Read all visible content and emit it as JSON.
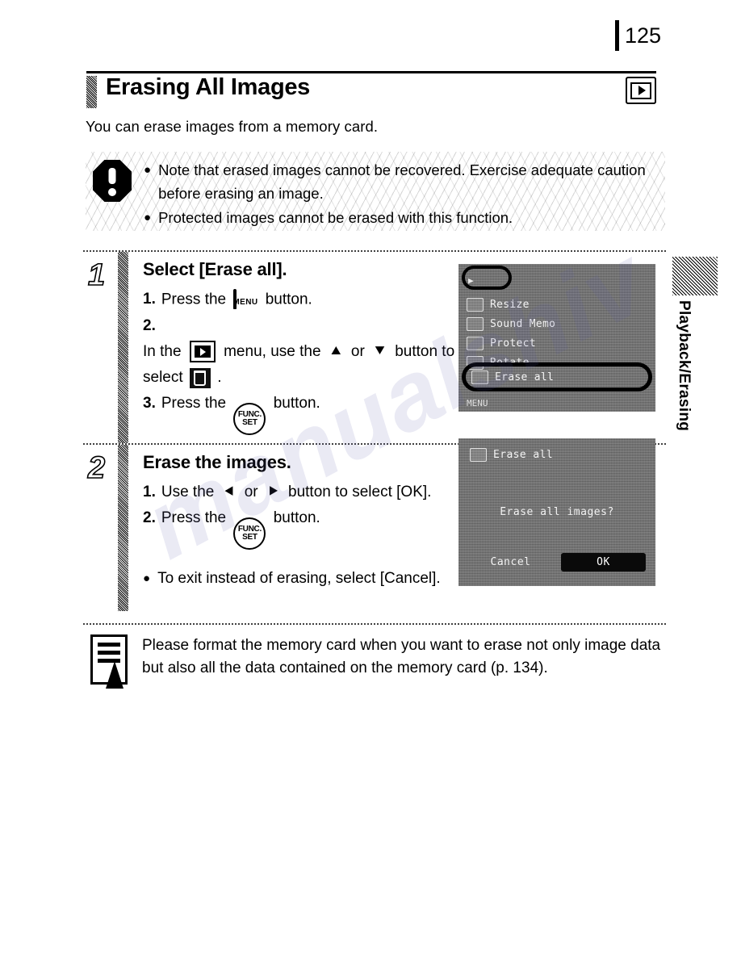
{
  "page": {
    "number": "125",
    "watermark": "manualshiv"
  },
  "header": {
    "title": "Erasing All Images",
    "mode_icon": "playback-icon",
    "intro": "You can erase images from a memory card."
  },
  "caution": {
    "icon": "exclamation-octagon-icon",
    "items": [
      "Note that erased images cannot be recovered. Exercise adequate caution before erasing an image.",
      "Protected images cannot be erased with this function."
    ]
  },
  "steps": [
    {
      "number": "1",
      "heading": "Select [Erase all].",
      "substeps": [
        {
          "marker": "1.",
          "before": "Press the",
          "icon": "menu-button-icon",
          "after": "button."
        },
        {
          "marker": "2.",
          "before": "In the",
          "icon": "playback-menu-icon",
          "mid": "menu, use the",
          "icon2": "up-arrow-icon",
          "or": "or",
          "icon3": "down-arrow-icon",
          "after": "button to select",
          "icon4": "erase-all-trash-icon",
          "tail": "."
        },
        {
          "marker": "3.",
          "before": "Press the",
          "icon": "func-set-button-icon",
          "after": "button."
        }
      ]
    },
    {
      "number": "2",
      "heading": "Erase the images.",
      "substeps": [
        {
          "marker": "1.",
          "before": "Use the",
          "icon": "left-arrow-icon",
          "or": "or",
          "icon2": "right-arrow-icon",
          "after": "button to select [OK]."
        },
        {
          "marker": "2.",
          "before": "Press the",
          "icon": "func-set-button-icon",
          "after": "button."
        }
      ],
      "note": "To exit instead of erasing, select [Cancel]."
    }
  ],
  "lcd_menu": {
    "tab_highlighted": true,
    "rows": [
      {
        "icon": "resize-icon",
        "label": "Resize"
      },
      {
        "icon": "sound-memo-icon",
        "label": "Sound Memo"
      },
      {
        "icon": "protect-icon",
        "label": "Protect"
      },
      {
        "icon": "rotate-icon",
        "label": "Rotate"
      }
    ],
    "selected": {
      "icon": "trash-icon",
      "label": "Erase all"
    },
    "footer": "MENU"
  },
  "lcd_dialog": {
    "title": "Erase all",
    "title_icon": "trash-icon",
    "message": "Erase all images?",
    "buttons": [
      {
        "label": "Cancel",
        "selected": false
      },
      {
        "label": "OK",
        "selected": true
      }
    ]
  },
  "footer_note": {
    "icon": "note-pencil-icon",
    "text": "Please format the memory card when you want to erase not only image data but also all the data contained on the memory card (p. 134)."
  },
  "side_tab": {
    "label": "Playback/Erasing"
  },
  "colors": {
    "ink": "#000000",
    "paper": "#ffffff",
    "lcd_background": "#5a5a5a",
    "watermark": "#5a5aaa"
  }
}
